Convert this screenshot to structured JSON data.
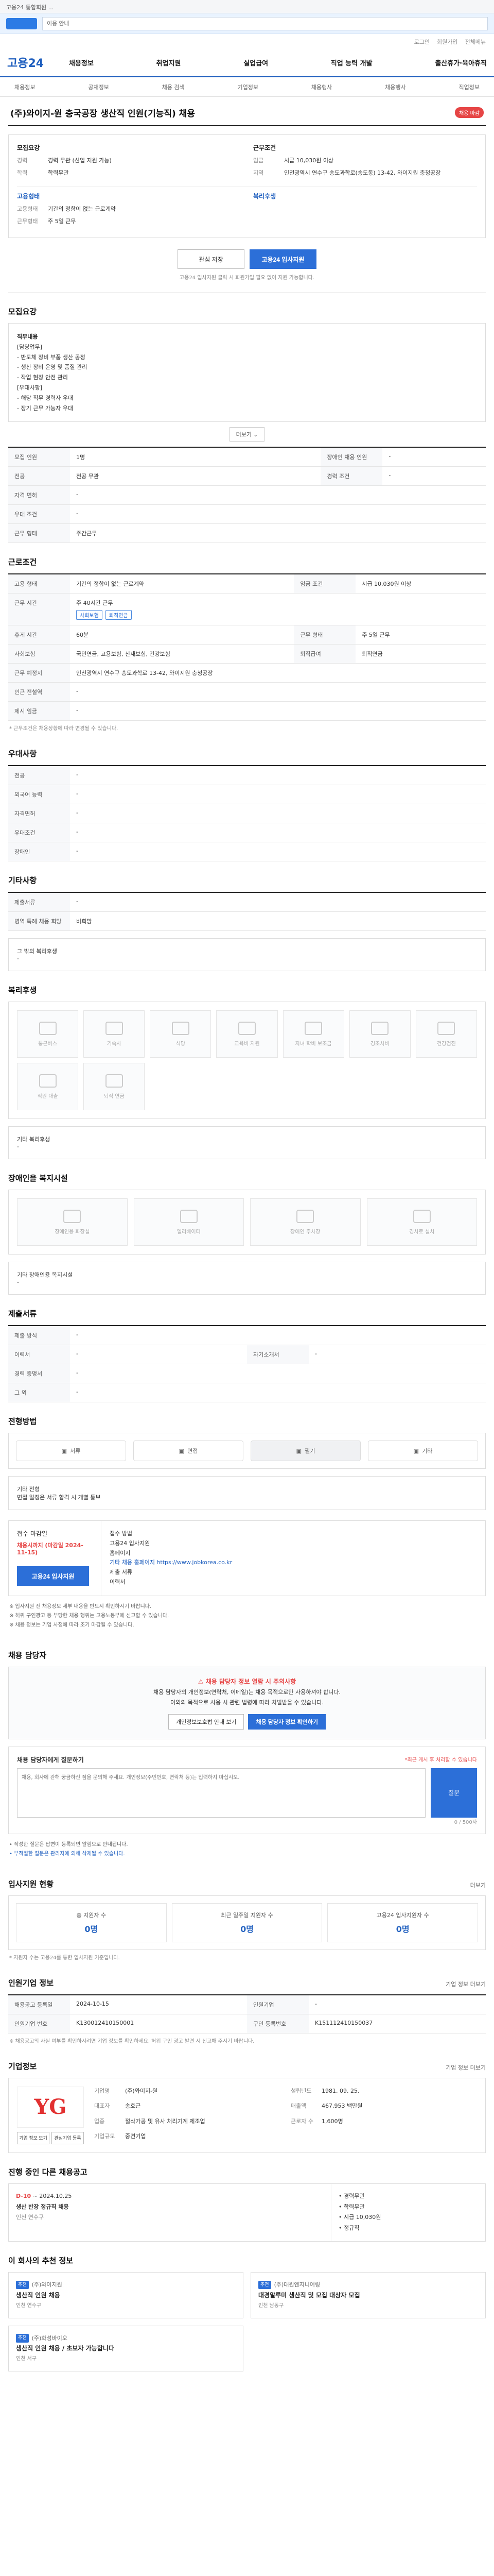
{
  "top_banner": "고용24 통합회원 ...",
  "notice": {
    "placeholder": "이용 안내"
  },
  "util_links": [
    "로그인",
    "회원가입",
    "전체메뉴"
  ],
  "gnb": {
    "brand": "고용24",
    "menu": [
      "채용정보",
      "취업지원",
      "실업급여",
      "직업 능력 개발",
      "출산휴가·육아휴직"
    ]
  },
  "subnav": [
    "채용정보",
    "공채정보",
    "채용 검색",
    "기업정보",
    "채용행사",
    "채용행사",
    "직업정보"
  ],
  "job": {
    "title": "(주)와이지-원 충국공장 생산직 인원(기능직) 채용",
    "badge": "채용 마감",
    "recruit_title": "모집요강",
    "work_title": "근무조건",
    "kv_left": [
      {
        "k": "경력",
        "v": "경력 무관 (신입 지원 가능)"
      },
      {
        "k": "학력",
        "v": "학력무관"
      }
    ],
    "kv_right": [
      {
        "k": "임금",
        "v": "시급 10,030원 이상"
      },
      {
        "k": "지역",
        "v": "인천광역시 연수구 송도과학로(송도동) 13-42, 와이지원 충청공장"
      }
    ],
    "sub_left_title": "고용형태",
    "kv_left2": [
      {
        "k": "고용형태",
        "v": "기간의 정함이 없는 근로계약"
      },
      {
        "k": "근무형태",
        "v": "주 5일 근무"
      }
    ],
    "sub_right_title": "복리후생"
  },
  "actions": {
    "save": "관심 저장",
    "apply": "고용24 입사지원",
    "note": "고용24 입사지원 클릭 시 회원가입 필요 없이 지원 가능합니다."
  },
  "sections": {
    "recruit": "모집요강",
    "conditions": "근로조건",
    "qualifications": "우대사항",
    "etc": "기타사항",
    "welfare": "복리후생",
    "disability": "장애인을 복지시설",
    "docs": "제출서류",
    "method": "전형방법",
    "manager": "채용 담당자",
    "applicants": "입사지원 현황",
    "hr_info": "인원기업 정보",
    "company": "기업정보",
    "ongoing": "진행 중인 다른 채용공고",
    "recommend": "이 회사의 추천 정보"
  },
  "recruit_box": {
    "head1": "직무내용",
    "lines": [
      "[담당업무]",
      "- 반도체 장비 부품 생산 공정",
      "- 생산 장비 운영 및 품질 관리",
      "- 작업 현장 안전 관리",
      "[우대사항]",
      "- 해당 직무 경력자 우대",
      "- 장기 근무 가능자 우대"
    ],
    "more": "더보기 ⌄"
  },
  "recruit_table": [
    {
      "k": "모집 인원",
      "v": "1명",
      "k2": "장애인 채용 인원",
      "v2": "-"
    },
    {
      "k": "전공",
      "v": "전공 무관",
      "k2": "경력 조건",
      "v2": "-"
    },
    {
      "k": "자격 면허",
      "v": "-",
      "k2": "",
      "v2": ""
    },
    {
      "k": "우대 조건",
      "v": "-",
      "k2": "",
      "v2": ""
    },
    {
      "k": "근무 형태",
      "v": "주간근무",
      "k2": "",
      "v2": ""
    }
  ],
  "cond_table": [
    {
      "k": "고용 형태",
      "v": "기간의 정함이 없는 근로계약",
      "k2": "임금 조건",
      "v2": "시급 10,030원 이상"
    },
    {
      "k": "근무 시간",
      "v": "주 40시간 근무",
      "k2": "",
      "v2": ""
    },
    {
      "k": "휴게 시간",
      "v": "60분",
      "k2": "근무 형태",
      "v2": "주 5일 근무"
    },
    {
      "k": "사회보험",
      "v": "국민연금, 고용보험, 산재보험, 건강보험",
      "k2": "퇴직급여",
      "v2": "퇴직연금"
    },
    {
      "k": "근무 예정지",
      "v": "인천광역시 연수구 송도과학로 13-42, 와이지원 충청공장",
      "k2": "",
      "v2": ""
    },
    {
      "k": "인근 전철역",
      "v": "-",
      "k2": "",
      "v2": ""
    },
    {
      "k": "제시 임금",
      "v": "-",
      "k2": "",
      "v2": ""
    }
  ],
  "cond_tags": [
    "사회보험",
    "퇴직연금"
  ],
  "cond_note": "* 근무조건은 채용상황에 따라 변경될 수 있습니다.",
  "qual_table": [
    {
      "k": "전공",
      "v": "-"
    },
    {
      "k": "외국어 능력",
      "v": "-"
    },
    {
      "k": "자격면허",
      "v": "-"
    },
    {
      "k": "우대조건",
      "v": "-"
    },
    {
      "k": "장애인",
      "v": "-"
    }
  ],
  "etc_table": [
    {
      "k": "제출서류",
      "v": "-"
    },
    {
      "k": "병역 특례 채용 희망",
      "v": "비희망"
    }
  ],
  "etc_extra": "그 밖의 복리후생",
  "etc_extra_v": "-",
  "welfare_icons": [
    "통근버스",
    "기숙사",
    "식당",
    "교육비 지원",
    "자녀 학비 보조금",
    "경조사비",
    "건강검진",
    "직원 대출",
    "퇴직 연금"
  ],
  "welfare_note_k": "기타 복리후생",
  "welfare_note_v": "-",
  "disability_icons": [
    "장애인용 화장실",
    "엘리베이터",
    "장애인 주차장",
    "경사로 설치"
  ],
  "disability_note_k": "기타 장애인용 복지시설",
  "disability_note_v": "-",
  "docs_table": [
    {
      "k": "제출 방식",
      "v": "-",
      "k2": "",
      "v2": ""
    },
    {
      "k": "이력서",
      "v": "-",
      "k2": "자기소개서",
      "v2": "-"
    },
    {
      "k": "경력 증명서",
      "v": "-",
      "k2": "",
      "v2": ""
    },
    {
      "k": "그 외",
      "v": "-",
      "k2": "",
      "v2": ""
    }
  ],
  "method": {
    "options": [
      "서류",
      "면접",
      "필기",
      "기타"
    ],
    "detail_k": "기타 전형",
    "detail_v": "면접 일정은 서류 합격 시 개별 통보"
  },
  "apply": {
    "deadline_label": "접수 마감일",
    "deadline": "채용시까지 (마감일 2024-11-15)",
    "method_label": "접수 방법",
    "method_v": "고용24 입사지원",
    "url_label": "홈페이지",
    "url_v": "기타 채용 홈페이지 https://www.jobkorea.co.kr",
    "docs_label": "제출 서류",
    "docs_v": "이력서",
    "button": "고용24 입사지원"
  },
  "apply_bullets": [
    "※ 입사지원 전 채용정보 세부 내용을 반드시 확인하시기 바랍니다.",
    "※ 허위 구인광고 등 부당한 채용 행위는 고용노동부에 신고할 수 있습니다.",
    "※ 채용 정보는 기업 사정에 따라 조기 마감될 수 있습니다."
  ],
  "manager": {
    "warn": "채용 담당자 정보 열람 시 주의사항",
    "line1": "채용 담당자의 개인정보(연락처, 이메일)는 채용 목적으로만 사용하셔야 합니다.",
    "line2": "이외의 목적으로 사용 시 관련 법령에 따라 처벌받을 수 있습니다.",
    "btn1": "개인정보보호법 안내 보기",
    "btn2": "채용 담당자 정보 확인하기"
  },
  "inquiry": {
    "title": "채용 담당자에게 질문하기",
    "note": "*최근 게시 후 처리할 수 있습니다",
    "placeholder": "채용, 회사에 관해 궁금하신 점을 문의해 주세요. 개인정보(주민번호, 연락처 등)는 입력하지 마십시오.",
    "counter": "0 / 500자",
    "button": "질문",
    "foot1": "• 작성한 질문은 답변이 등록되면 알림으로 안내됩니다.",
    "foot2": "• 부적절한 질문은 관리자에 의해 삭제될 수 있습니다."
  },
  "applicants": {
    "right": "더보기",
    "stats": [
      {
        "label": "총 지원자 수",
        "value": "0명"
      },
      {
        "label": "최근 일주일 지원자 수",
        "value": "0명"
      },
      {
        "label": "고용24 입사지원자 수",
        "value": "0명"
      }
    ],
    "note": "* 지원자 수는 고용24를 통한 입사지원 기준입니다."
  },
  "hr": {
    "right": "기업 정보 더보기",
    "rows": [
      {
        "k": "채용공고 등록일",
        "v": "2024-10-15",
        "k2": "인원기업",
        "v2": "-"
      },
      {
        "k": "인원기업 번호",
        "v": "K130012410150001",
        "k2": "구인 등록번호",
        "v2": "K151112410150037"
      }
    ],
    "note": "※ 채용공고의 사실 여부를 확인하시려면 기업 정보를 확인하세요. 허위 구인 광고 발견 시 신고해 주시기 바랍니다."
  },
  "company": {
    "logo": "YG",
    "right": "기업 정보 더보기",
    "meta": [
      {
        "k": "기업명",
        "v": "(주)와이지-원"
      },
      {
        "k": "설립년도",
        "v": "1981. 09. 25."
      },
      {
        "k": "대표자",
        "v": "송호근"
      },
      {
        "k": "매출액",
        "v": "467,953 백만원"
      },
      {
        "k": "업종",
        "v": "절삭가공 및 유사 처리기계 제조업"
      },
      {
        "k": "근로자 수",
        "v": "1,600명"
      },
      {
        "k": "기업규모",
        "v": "중견기업"
      },
      {
        "k": "",
        "v": ""
      }
    ],
    "btn1": "기업 정보 보기",
    "btn2": "관심기업 등록"
  },
  "ongoing": {
    "dday": "D-10",
    "date": "~ 2024.10.25",
    "title": "생산 반장 정규직 채용",
    "loc": "인천 연수구",
    "right_lines": [
      "• 경력무관",
      "• 학력무관",
      "• 시급 10,030원",
      "• 정규직"
    ]
  },
  "recommend": [
    {
      "badge": "추천",
      "company": "(주)와이지원",
      "title": "생산직 인원 채용",
      "loc": "인천 연수구"
    },
    {
      "badge": "추천",
      "company": "(주)대원엔지니어링",
      "title": "대경알루미 생산직 및 모집 대상자 모집",
      "loc": "인천 남동구"
    },
    {
      "badge": "추천",
      "company": "(주)화성바이오",
      "title": "생산직 인원 채용 / 초보자 가능합니다",
      "loc": "인천 서구"
    }
  ]
}
